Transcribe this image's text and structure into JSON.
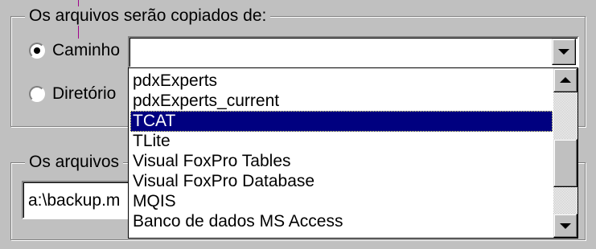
{
  "source_group": {
    "legend": "Os arquivos serão copiados de:",
    "radio_path": {
      "label": "Caminho",
      "checked": true
    },
    "radio_directory": {
      "label": "Diretório",
      "checked": false
    },
    "path_combo": {
      "value": ""
    }
  },
  "dest_group": {
    "legend": "Os arquivos",
    "path_field": {
      "value": "a:\\backup.m"
    }
  },
  "dropdown": {
    "items": [
      "pdxExperts",
      "pdxExperts_current",
      "TCAT",
      "TLite",
      "Visual FoxPro Tables",
      "Visual FoxPro Database",
      "MQIS",
      "Banco de dados MS Access"
    ],
    "selected_index": 2
  },
  "icons": {
    "combo_arrow": "chevron-down-icon",
    "scroll_up": "arrow-up-icon",
    "scroll_down": "arrow-down-icon"
  },
  "colors": {
    "face": "#c0c0c0",
    "selection": "#000080",
    "pointer": "#a0008c"
  }
}
